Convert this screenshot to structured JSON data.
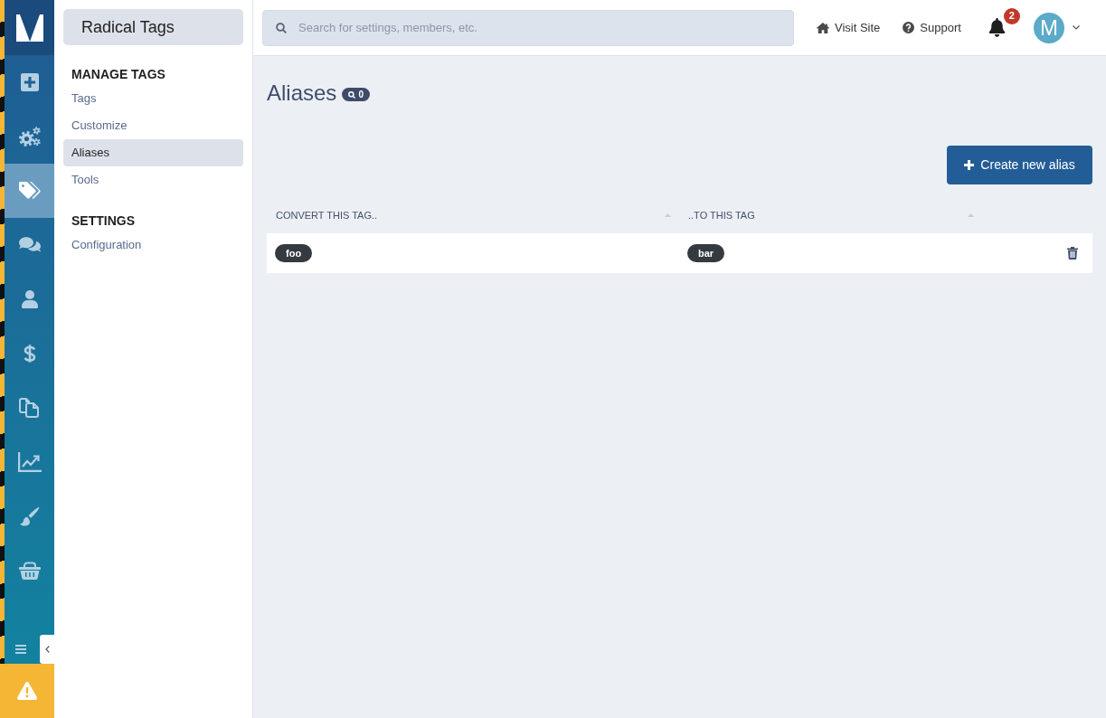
{
  "rail": {
    "items": [
      {
        "kind": "plus",
        "selected": false
      },
      {
        "kind": "gears",
        "selected": false
      },
      {
        "kind": "tags",
        "selected": true
      },
      {
        "kind": "chat",
        "selected": false
      },
      {
        "kind": "user",
        "selected": false
      },
      {
        "kind": "dollar",
        "selected": false
      },
      {
        "kind": "copy",
        "selected": false
      },
      {
        "kind": "chart",
        "selected": false
      },
      {
        "kind": "brush",
        "selected": false
      },
      {
        "kind": "basket",
        "selected": false
      }
    ]
  },
  "sidebar": {
    "title": "Radical Tags",
    "sections": [
      {
        "heading": "MANAGE TAGS",
        "items": [
          {
            "label": "Tags",
            "selected": false
          },
          {
            "label": "Customize",
            "selected": false
          },
          {
            "label": "Aliases",
            "selected": true
          },
          {
            "label": "Tools",
            "selected": false
          }
        ]
      },
      {
        "heading": "SETTINGS",
        "items": [
          {
            "label": "Configuration",
            "selected": false
          }
        ]
      }
    ]
  },
  "topbar": {
    "search": {
      "placeholder": "Search for settings, members, etc."
    },
    "links": [
      {
        "kind": "home",
        "label": "Visit Site"
      },
      {
        "kind": "help",
        "label": "Support"
      }
    ],
    "notifications": {
      "count": "2"
    },
    "avatar": {
      "initial": "M"
    }
  },
  "page": {
    "title": "Aliases",
    "badge": "0",
    "create_button": "Create new alias",
    "table": {
      "columns": [
        {
          "label": "CONVERT THIS TAG.."
        },
        {
          "label": "..TO THIS TAG"
        }
      ],
      "rows": [
        {
          "cells": [
            "foo",
            "bar"
          ]
        }
      ]
    }
  }
}
